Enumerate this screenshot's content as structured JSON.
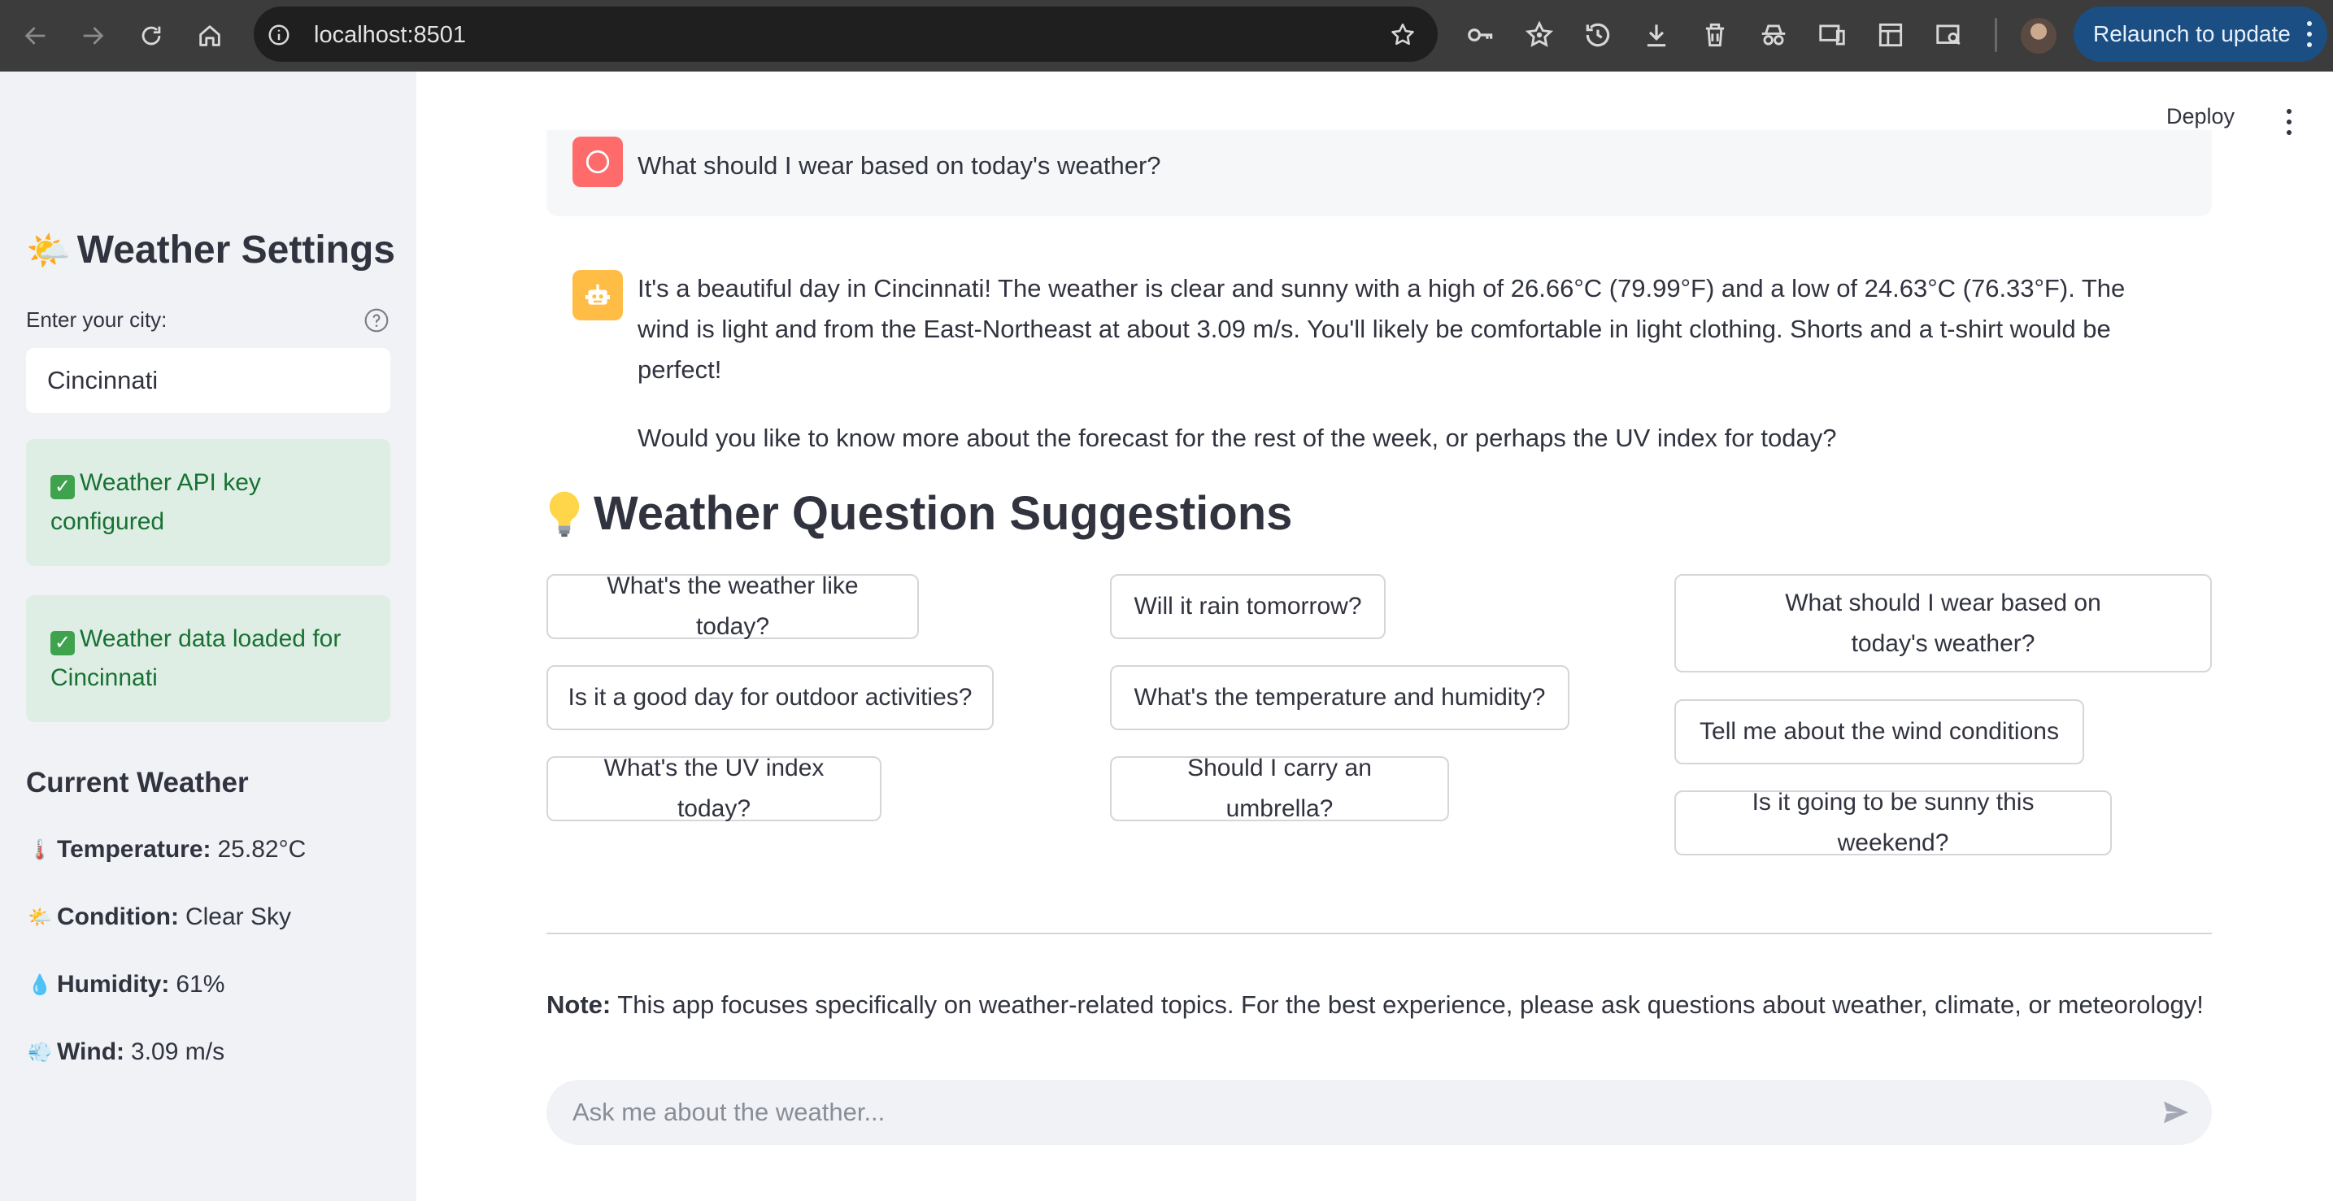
{
  "browser": {
    "url": "localhost:8501",
    "relaunch_label": "Relaunch to update"
  },
  "sidebar": {
    "title_emoji": "🌤️",
    "title": "Weather Settings",
    "city_label": "Enter your city:",
    "city_value": "Cincinnati",
    "alerts": [
      {
        "text": "Weather API key configured"
      },
      {
        "text": "Weather data loaded for Cincinnati"
      }
    ],
    "current_weather_heading": "Current Weather",
    "metrics": [
      {
        "emoji": "🌡️",
        "label": "Temperature:",
        "value": "25.82°C"
      },
      {
        "emoji": "🌤️",
        "label": "Condition:",
        "value": "Clear Sky"
      },
      {
        "emoji": "💧",
        "label": "Humidity:",
        "value": "61%"
      },
      {
        "emoji": "💨",
        "label": "Wind:",
        "value": "3.09 m/s"
      }
    ]
  },
  "header": {
    "deploy_label": "Deploy"
  },
  "chat": {
    "user_message": "What should I wear based on today's weather?",
    "assistant_paragraphs": [
      "It's a beautiful day in Cincinnati! The weather is clear and sunny with a high of 26.66°C (79.99°F) and a low of 24.63°C (76.33°F). The wind is light and from the East-Northeast at about 3.09 m/s. You'll likely be comfortable in light clothing. Shorts and a t-shirt would be perfect!",
      "Would you like to know more about the forecast for the rest of the week, or perhaps the UV index for today?"
    ]
  },
  "suggestions": {
    "heading": "Weather Question Suggestions",
    "items": [
      "What's the weather like today?",
      "Is it a good day for outdoor activities?",
      "What's the UV index today?",
      "Will it rain tomorrow?",
      "What's the temperature and humidity?",
      "Should I carry an umbrella?",
      "What should I wear based on today's weather?",
      "Tell me about the wind conditions",
      "Is it going to be sunny this weekend?"
    ]
  },
  "note": {
    "bold": "Note:",
    "text": "This app focuses specifically on weather-related topics. For the best experience, please ask questions about weather, climate, or meteorology!"
  },
  "chat_input": {
    "placeholder": "Ask me about the weather..."
  },
  "colors": {
    "sidebar_bg": "#f0f2f6",
    "success_bg": "#dfeee4",
    "success_text": "#177233",
    "user_avatar": "#ff6b6b",
    "assistant_avatar": "#ffbd45",
    "relaunch_bg": "#1b4f84"
  }
}
